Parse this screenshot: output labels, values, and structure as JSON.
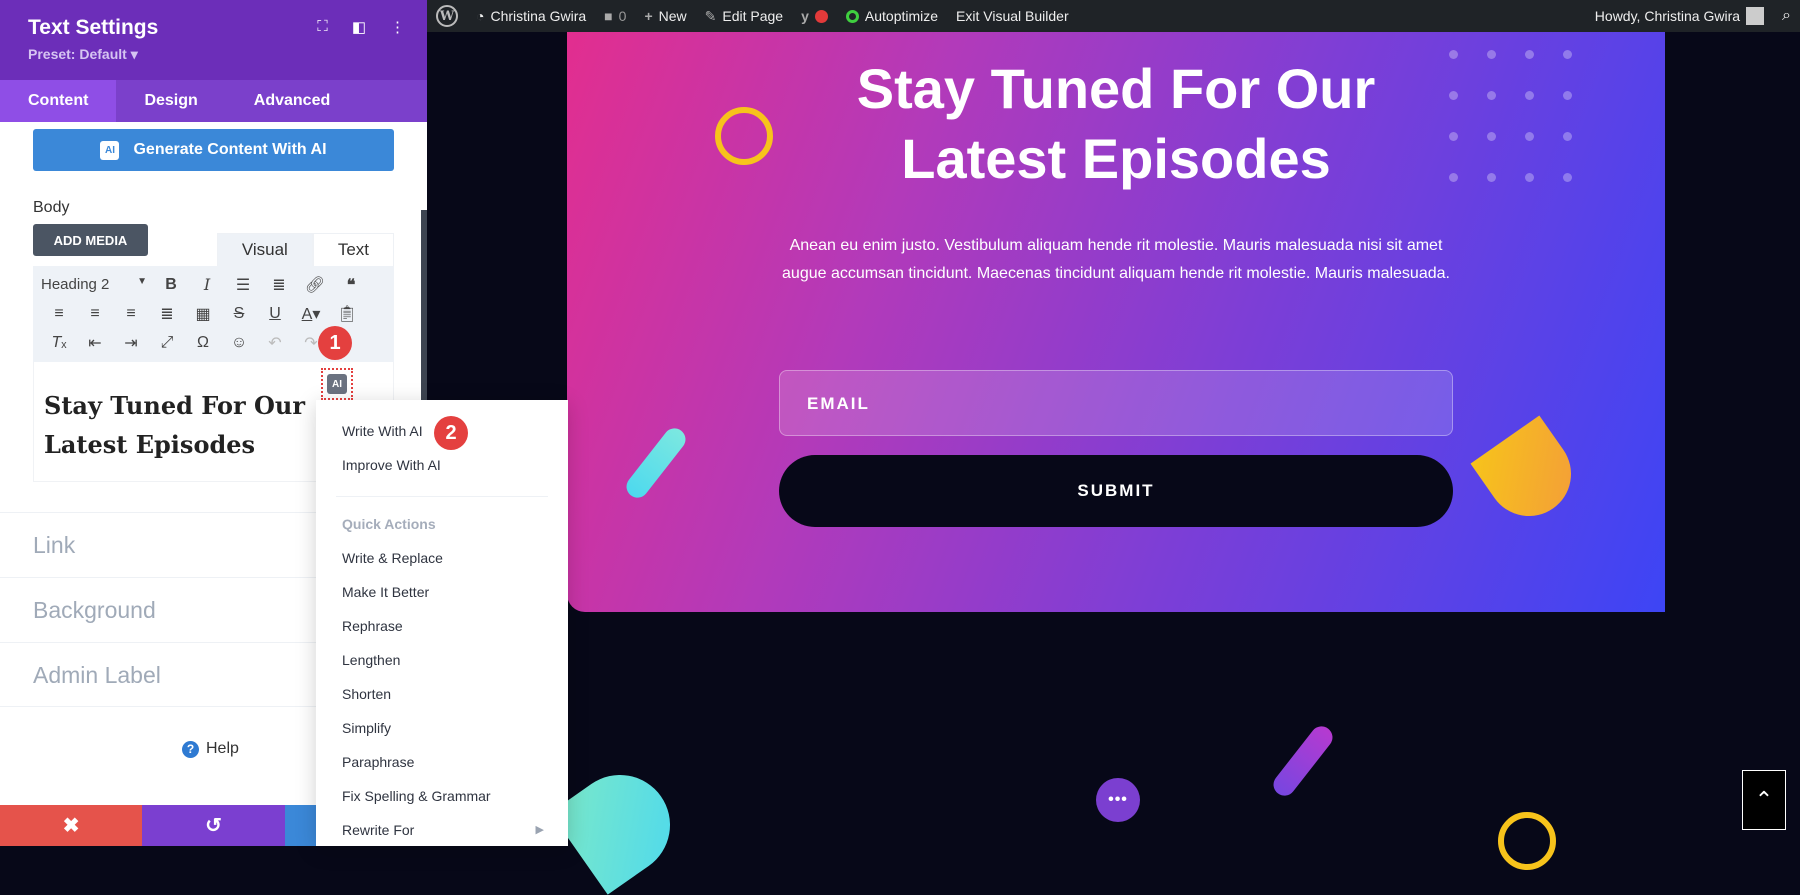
{
  "adminbar": {
    "site_name": "Christina Gwira",
    "comments_count": "0",
    "new_label": "New",
    "edit_label": "Edit Page",
    "autoptimize_label": "Autoptimize",
    "exit_label": "Exit Visual Builder",
    "howdy": "Howdy, Christina Gwira"
  },
  "panel": {
    "title": "Text Settings",
    "preset": "Preset: Default ▾",
    "tabs": [
      {
        "label": "Content",
        "active": true
      },
      {
        "label": "Design",
        "active": false
      },
      {
        "label": "Advanced",
        "active": false
      }
    ],
    "ai_button": "Generate Content With AI",
    "ai_badge": "AI",
    "body_label": "Body",
    "add_media": "ADD MEDIA",
    "editor_tabs": {
      "visual": "Visual",
      "text": "Text"
    },
    "format_select": "Heading 2",
    "content_heading": "Stay Tuned For Our Latest Episodes",
    "sections": [
      "Link",
      "Background",
      "Admin Label"
    ],
    "help": "Help",
    "step_badges": [
      "1",
      "2"
    ]
  },
  "ai_menu": {
    "items": [
      "Write With AI",
      "Improve With AI"
    ],
    "quick_actions_header": "Quick Actions",
    "quick_actions": [
      "Write & Replace",
      "Make It Better",
      "Rephrase",
      "Lengthen",
      "Shorten",
      "Simplify",
      "Paraphrase",
      "Fix Spelling & Grammar",
      "Rewrite For"
    ]
  },
  "hero": {
    "title_line1": "Stay Tuned For Our",
    "title_line2": "Latest Episodes",
    "text": "Anean eu enim justo. Vestibulum aliquam hende rit molestie. Mauris malesuada nisi sit amet augue accumsan tincidunt. Maecenas tincidunt aliquam hende rit molestie. Mauris malesuada.",
    "email_placeholder": "EMAIL",
    "submit": "SUBMIT"
  },
  "colors": {
    "panel_header": "#6c2eb9",
    "ai_button": "#3b88d8",
    "badge_red": "#e4403f",
    "cancel": "#e5534b",
    "undo": "#7b3fd0",
    "redo": "#3b88d8"
  }
}
